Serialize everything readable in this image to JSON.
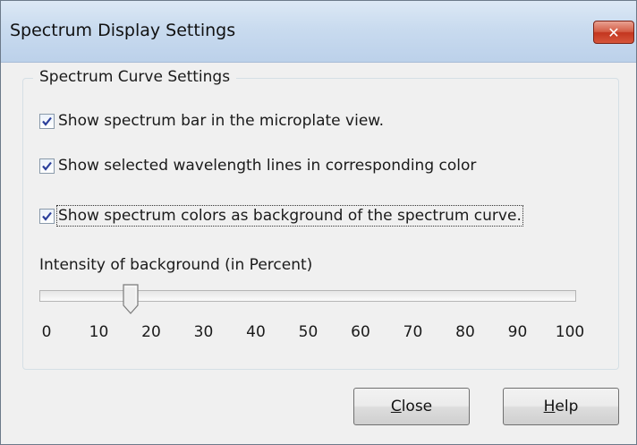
{
  "window": {
    "title": "Spectrum Display Settings",
    "close_glyph": "✕"
  },
  "group": {
    "legend": "Spectrum Curve Settings",
    "checkboxes": [
      {
        "label": "Show spectrum bar in the microplate view.",
        "checked": true
      },
      {
        "label": "Show selected wavelength lines in corresponding color",
        "checked": true
      },
      {
        "label": "Show spectrum colors as background of the spectrum curve.",
        "checked": true,
        "focused": true
      }
    ],
    "slider": {
      "label": "Intensity of background (in Percent)",
      "value_percent": 16,
      "tick_labels": [
        "0",
        "10",
        "20",
        "30",
        "40",
        "50",
        "60",
        "70",
        "80",
        "90",
        "100"
      ]
    }
  },
  "buttons": {
    "close": {
      "mnemonic": "C",
      "rest": "lose"
    },
    "help": {
      "mnemonic": "H",
      "rest": "elp"
    }
  }
}
